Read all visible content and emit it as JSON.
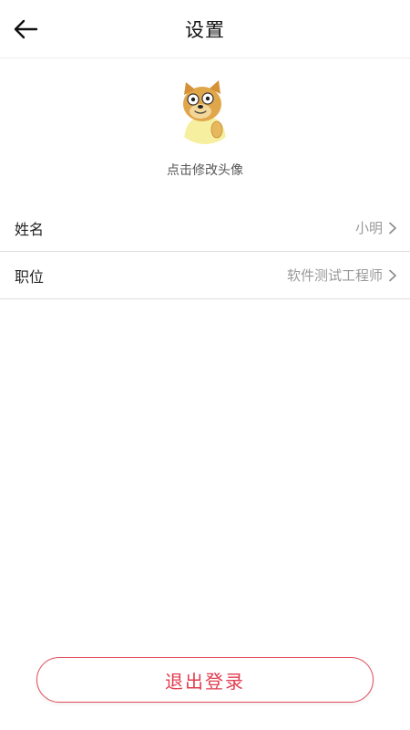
{
  "header": {
    "title": "设置",
    "back_icon": "arrow-left-icon"
  },
  "avatar": {
    "icon": "doge-avatar-image",
    "hint": "点击修改头像"
  },
  "fields": [
    {
      "label": "姓名",
      "value": "小明",
      "icon": "chevron-right-icon"
    },
    {
      "label": "职位",
      "value": "软件测试工程师",
      "icon": "chevron-right-icon"
    }
  ],
  "logout": {
    "label": "退出登录"
  },
  "colors": {
    "accent": "#e23d4f",
    "border": "#dddddd",
    "value_text": "#999999"
  }
}
